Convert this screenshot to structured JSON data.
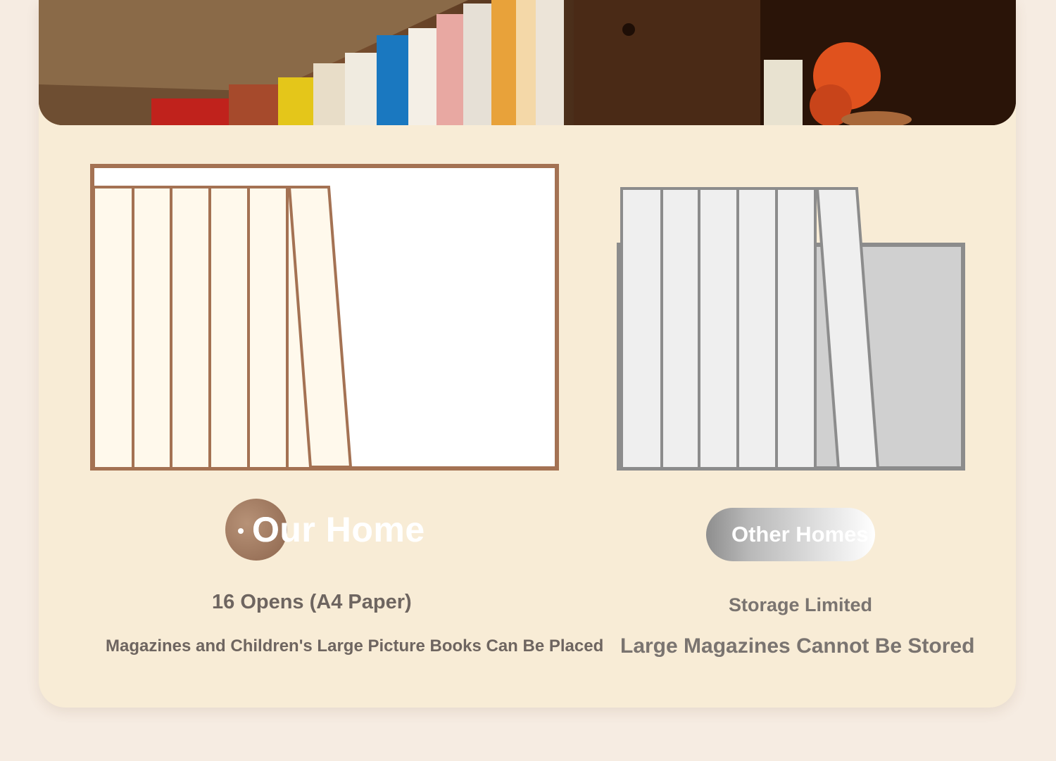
{
  "comparison": {
    "ours": {
      "title": "Our Home",
      "spec": "16 Opens (A4 Paper)",
      "note": "Magazines and Children's Large Picture Books Can Be Placed"
    },
    "others": {
      "title": "Other Homes",
      "spec": "Storage Limited",
      "note": "Large Magazines Cannot Be Stored"
    }
  },
  "colors": {
    "page_bg": "#f6ece2",
    "card_bg": "#f8ecd6",
    "ours_frame": "#a47253",
    "others_frame": "#8c8c8c",
    "text_dark": "#6e6560"
  }
}
